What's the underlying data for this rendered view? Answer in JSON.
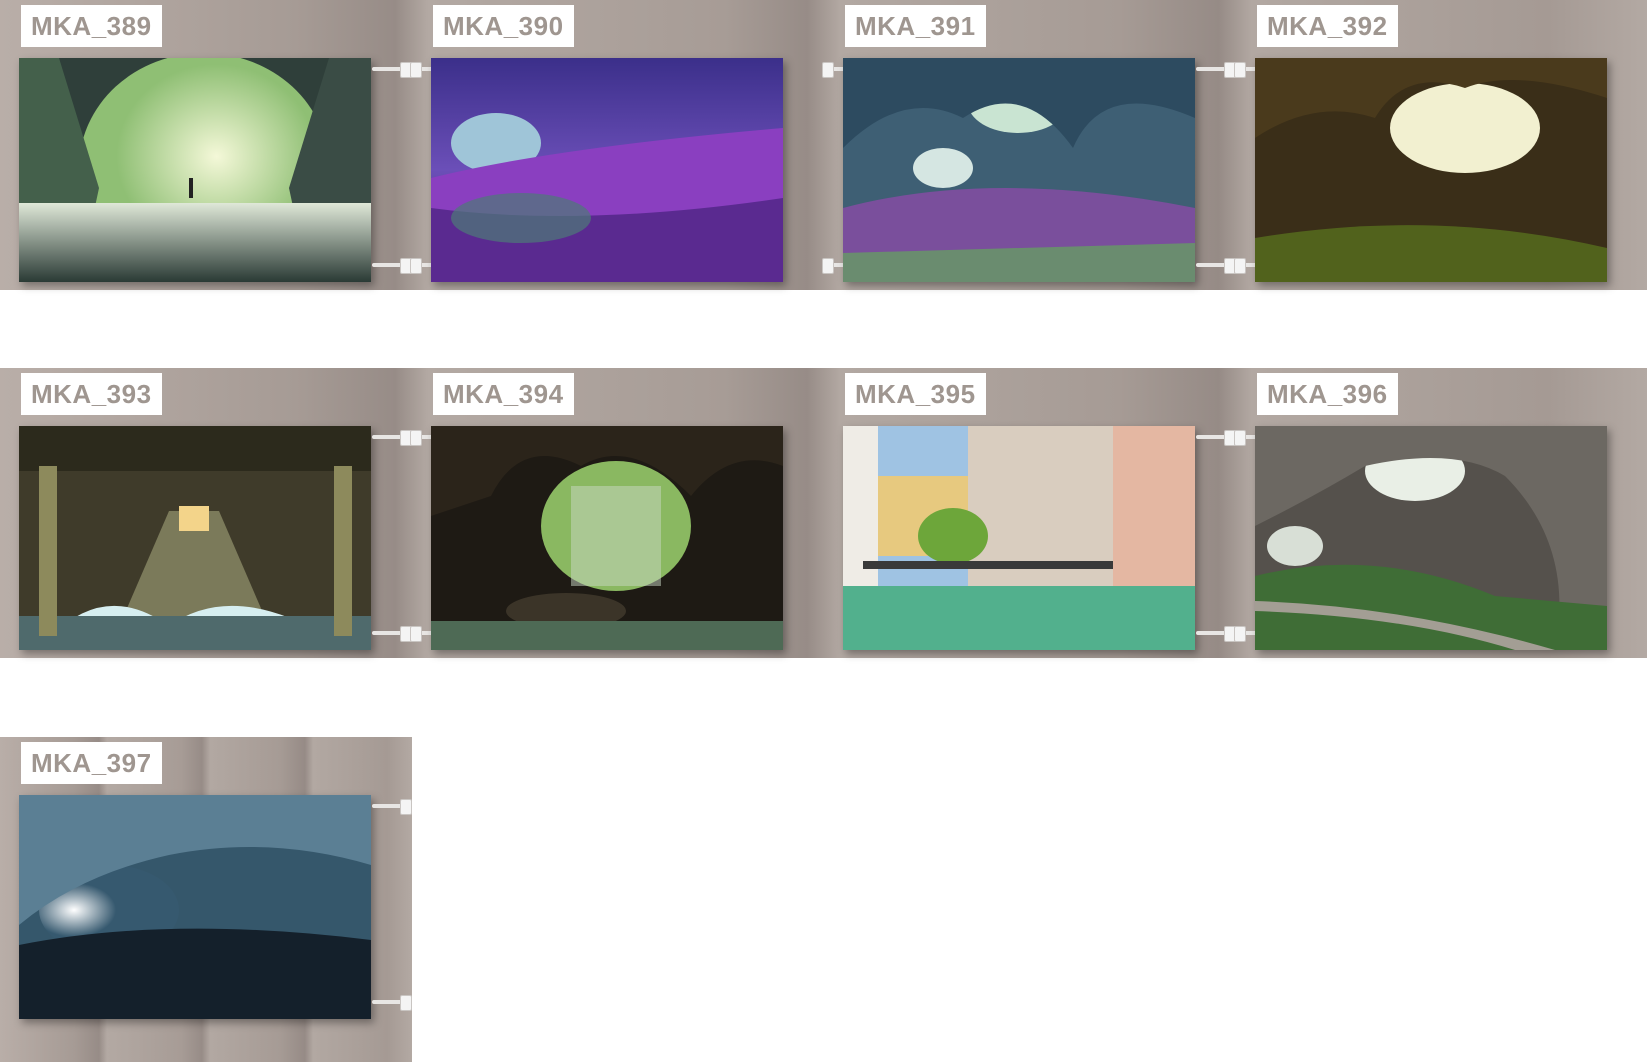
{
  "tiles": [
    {
      "code": "MKA_389",
      "theme": "tunnel-green"
    },
    {
      "code": "MKA_390",
      "theme": "cave-purple"
    },
    {
      "code": "MKA_391",
      "theme": "cave-blue-purple"
    },
    {
      "code": "MKA_392",
      "theme": "cave-green-sun"
    },
    {
      "code": "MKA_393",
      "theme": "pier-waves"
    },
    {
      "code": "MKA_394",
      "theme": "cave-waterfall"
    },
    {
      "code": "MKA_395",
      "theme": "canal-town"
    },
    {
      "code": "MKA_396",
      "theme": "cave-grey"
    },
    {
      "code": "MKA_397",
      "theme": "ice-tunnel"
    }
  ],
  "colors": {
    "label_text": "#9f9690",
    "label_bg": "#ffffff",
    "wall": "#a69b95"
  }
}
